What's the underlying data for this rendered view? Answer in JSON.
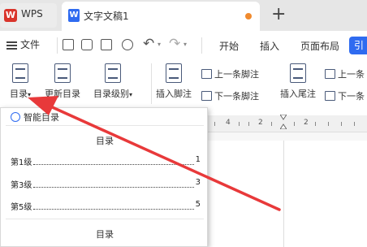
{
  "titlebar": {
    "wps_tab_label": "WPS",
    "doc_tab_label": "文字文稿1",
    "new_tab_symbol": "+"
  },
  "menubar": {
    "file_label": "文件",
    "tabs": [
      "开始",
      "插入",
      "页面布局"
    ],
    "partial_tab": "引"
  },
  "ribbon": {
    "toc_label": "目录",
    "update_toc_label": "更新目录",
    "toc_level_label": "目录级别",
    "insert_footnote_label": "插入脚注",
    "prev_footnote_label": "上一条脚注",
    "next_footnote_label": "下一条脚注",
    "insert_endnote_label": "插入尾注",
    "prev_endnote_label": "上一条",
    "next_endnote_label": "下一条"
  },
  "toc_panel": {
    "smart_toc_label": "智能目录",
    "sample_title": "目录",
    "entries": [
      {
        "label": "第1级",
        "page": "1"
      },
      {
        "label": "第3级",
        "page": "3"
      },
      {
        "label": "第5级",
        "page": "5"
      }
    ],
    "second_sample_title": "目录"
  },
  "ruler": {
    "numbers": [
      "4",
      "2",
      "2"
    ]
  },
  "colors": {
    "accent": "#2f6bf0",
    "arrow": "#e8393a",
    "active_button_bg": "#d6e6fb"
  }
}
